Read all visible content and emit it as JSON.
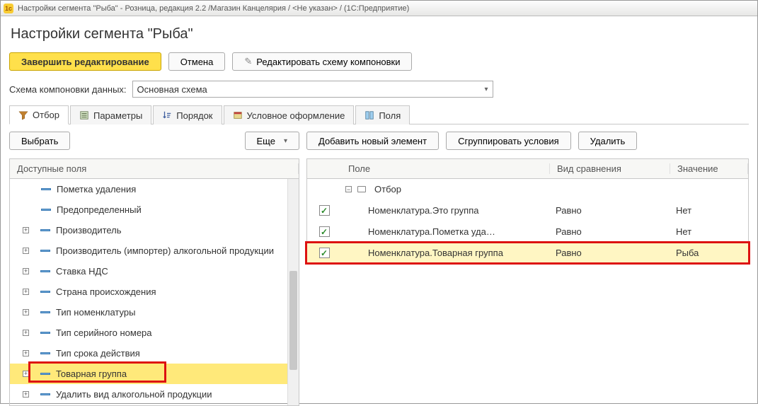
{
  "titlebar": "Настройки сегмента \"Рыба\" - Розница, редакция 2.2 /Магазин Канцелярия / <Не указан> /  (1С:Предприятие)",
  "page_title": "Настройки сегмента \"Рыба\"",
  "toolbar": {
    "finish": "Завершить редактирование",
    "cancel": "Отмена",
    "edit_scheme": "Редактировать схему компоновки"
  },
  "schema": {
    "label": "Схема компоновки данных:",
    "value": "Основная схема"
  },
  "tabs": {
    "filter": "Отбор",
    "params": "Параметры",
    "order": "Порядок",
    "format": "Условное оформление",
    "fields": "Поля"
  },
  "left": {
    "select_btn": "Выбрать",
    "more_btn": "Еще",
    "header": "Доступные поля",
    "items": [
      {
        "label": "Пометка удаления",
        "expand": false
      },
      {
        "label": "Предопределенный",
        "expand": false
      },
      {
        "label": "Производитель",
        "expand": true
      },
      {
        "label": "Производитель (импортер) алкогольной продукции",
        "expand": true
      },
      {
        "label": "Ставка НДС",
        "expand": true
      },
      {
        "label": "Страна происхождения",
        "expand": true
      },
      {
        "label": "Тип номенклатуры",
        "expand": true
      },
      {
        "label": "Тип серийного номера",
        "expand": true
      },
      {
        "label": "Тип срока действия",
        "expand": true
      },
      {
        "label": "Товарная группа",
        "expand": true,
        "highlight": true
      },
      {
        "label": "Удалить вид алкогольной продукции",
        "expand": true
      }
    ]
  },
  "right": {
    "add_btn": "Добавить новый элемент",
    "group_btn": "Сгруппировать условия",
    "delete_btn": "Удалить",
    "headers": {
      "field": "Поле",
      "compare": "Вид сравнения",
      "value": "Значение"
    },
    "root_label": "Отбор",
    "rows": [
      {
        "field": "Номенклатура.Это группа",
        "compare": "Равно",
        "value": "Нет"
      },
      {
        "field": "Номенклатура.Пометка уда…",
        "compare": "Равно",
        "value": "Нет"
      },
      {
        "field": "Номенклатура.Товарная группа",
        "compare": "Равно",
        "value": "Рыба",
        "selected": true
      }
    ]
  }
}
